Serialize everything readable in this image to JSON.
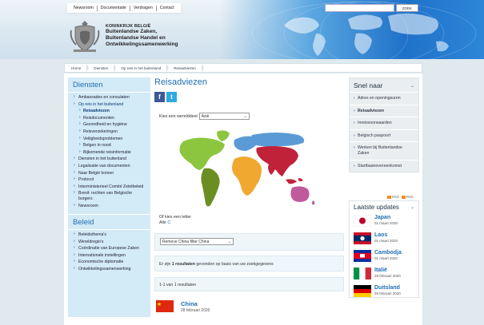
{
  "topnav": [
    "Newsroom",
    "Documentatie",
    "Verdragen",
    "Contact"
  ],
  "search": {
    "placeholder": "",
    "button": "ZOEK"
  },
  "brand": {
    "kingdom": "KONINKRIJK BELGIË",
    "line1": "Buitenlandse Zaken,",
    "line2": "Buitenlandse Handel en",
    "line3": "Ontwikkelingssamenwerking"
  },
  "breadcrumb": [
    "Home",
    "Diensten",
    "Op reis in het buitenland",
    "Reisadviezen"
  ],
  "sidebar": {
    "title": "Diensten",
    "items": [
      {
        "label": "Ambassades en consulaten",
        "sub": false,
        "state": ""
      },
      {
        "label": "Op reis in het buitenland",
        "sub": false,
        "state": "open"
      },
      {
        "label": "Reisadviezen",
        "sub": true,
        "state": "active"
      },
      {
        "label": "Reisdocumenten",
        "sub": true,
        "state": ""
      },
      {
        "label": "Gezondheid en hygiëne",
        "sub": true,
        "state": ""
      },
      {
        "label": "Reisverzekeringen",
        "sub": true,
        "state": ""
      },
      {
        "label": "Veiligheidsproblemen",
        "sub": true,
        "state": ""
      },
      {
        "label": "Belgen in nood",
        "sub": true,
        "state": ""
      },
      {
        "label": "Bijkomende reisinformatie",
        "sub": true,
        "state": ""
      },
      {
        "label": "Diensten in het buitenland",
        "sub": false,
        "state": ""
      },
      {
        "label": "Legalisatie van documenten",
        "sub": false,
        "state": ""
      },
      {
        "label": "Naar België komen",
        "sub": false,
        "state": ""
      },
      {
        "label": "Protocol",
        "sub": false,
        "state": ""
      },
      {
        "label": "Interministerieel Comité Zetelbeleid",
        "sub": false,
        "state": ""
      },
      {
        "label": "Brexit: rechten van Belgische burgers",
        "sub": false,
        "state": ""
      },
      {
        "label": "Newsroom",
        "sub": false,
        "state": ""
      }
    ],
    "title2": "Beleid",
    "items2": [
      "Beleidsthema's",
      "Wereldregio's",
      "Coördinatie van Europese Zaken",
      "Internationale instellingen",
      "Economische diplomatie",
      "Ontwikkelingssamenwerking"
    ]
  },
  "main": {
    "title": "Reisadviezen",
    "share_fb": "f",
    "share_tw": "t",
    "region_label": "Kies een werelddeel",
    "region_value": "Azië",
    "letter_label": "Of kies een letter",
    "letter_all": "Alle",
    "letter_c": "C",
    "filter_value": "Remove China filter China",
    "result_pre": "Er zijn ",
    "result_count": "1 resultaten",
    "result_post": " gevonden op basis van uw zoekgegevens",
    "pager": "1-1 van 1 resultaten",
    "result_name": "China",
    "result_date": "28 februari 2020"
  },
  "right": {
    "snel_title": "Snel naar",
    "snel_items": [
      {
        "label": "Adres en openingsuren",
        "active": false
      },
      {
        "label": "Reisadviezen",
        "active": true
      },
      {
        "label": "Inreisvoorwaarden",
        "active": false
      },
      {
        "label": "Belgisch paspoort",
        "active": false
      },
      {
        "label": "Werken bij Buitenlandse Zaken",
        "active": false
      },
      {
        "label": "Startbaanovereenkomst",
        "active": false
      }
    ],
    "rss1": "RSS",
    "rss2": "RSS",
    "updates_title": "Laatste updates",
    "updates": [
      {
        "name": "Japan",
        "date": "01 maart 2020",
        "flag": "japan"
      },
      {
        "name": "Laos",
        "date": "01 maart 2020",
        "flag": "laos"
      },
      {
        "name": "Cambodja",
        "date": "01 maart 2020",
        "flag": "cambodia"
      },
      {
        "name": "Italië",
        "date": "29 februari 2020",
        "flag": "italy"
      },
      {
        "name": "Duitsland",
        "date": "29 februari 2020",
        "flag": "germany"
      }
    ]
  },
  "colors": {
    "accent": "#1f6fb3",
    "sidebar": "#d3eaf7",
    "map_america_north": "#8cc63f",
    "map_america_south": "#6b8e23",
    "map_europe": "#5b9bd5",
    "map_africa": "#f0a830",
    "map_asia": "#c0223a",
    "map_oceania": "#c05a9c"
  }
}
